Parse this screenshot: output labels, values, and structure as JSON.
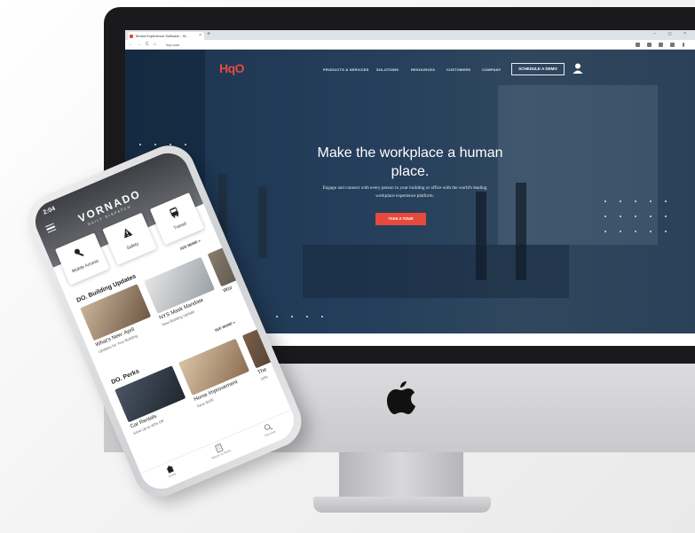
{
  "browser": {
    "tab_title": "Tenant Experience Software - Hi...",
    "tab_close": "×",
    "new_tab": "+",
    "window_controls": "– ◻ ×",
    "url": "hqo.com",
    "nav_back": "←",
    "nav_forward": "→",
    "nav_reload": "C",
    "nav_home": "⌂"
  },
  "site": {
    "logo": "HqO",
    "nav": [
      "PRODUCTS & SERVICES",
      "SOLUTIONS",
      "RESOURCES",
      "CUSTOMERS",
      "COMPANY"
    ],
    "cta_demo": "SCHEDULE A DEMO",
    "hero_title_line1": "Make the workplace a human",
    "hero_title_line2": "place.",
    "hero_sub_line1": "Engage and connect with every person in your building or office with the world's leading",
    "hero_sub_line2": "workplace experience platform.",
    "cta_tour": "TAKE A TOUR",
    "accent": "#e7493d",
    "hero_bg": "#1c3450"
  },
  "phone": {
    "time": "2:04",
    "brand": "VORNADO",
    "brand_sub": "DAILY DISPATCH",
    "tiles": [
      {
        "label": "Mobile Access",
        "icon": "key-icon"
      },
      {
        "label": "Safety",
        "icon": "warning-icon"
      },
      {
        "label": "Transit",
        "icon": "bus-icon"
      }
    ],
    "section1": {
      "title": "DO. Building Updates",
      "see_more": "SEE MORE >",
      "cards": [
        {
          "title": "What's New: April",
          "sub": "Updates for Your Building"
        },
        {
          "title": "NYS Mask Mandate",
          "sub": "New Building Update"
        },
        {
          "title": "Wor",
          "sub": ""
        }
      ]
    },
    "section2": {
      "title": "DO. Perks",
      "see_more": "SEE MORE >",
      "cards": [
        {
          "title": "Car Rentals",
          "sub": "Save Up to 40% Off"
        },
        {
          "title": "Home Improvement",
          "sub": "Save $100"
        },
        {
          "title": "The",
          "sub": "10%"
        }
      ]
    },
    "tabs": [
      {
        "label": "Home",
        "icon": "home-icon"
      },
      {
        "label": "Return to Work",
        "icon": "building-icon"
      },
      {
        "label": "Discover",
        "icon": "search-icon"
      }
    ]
  }
}
